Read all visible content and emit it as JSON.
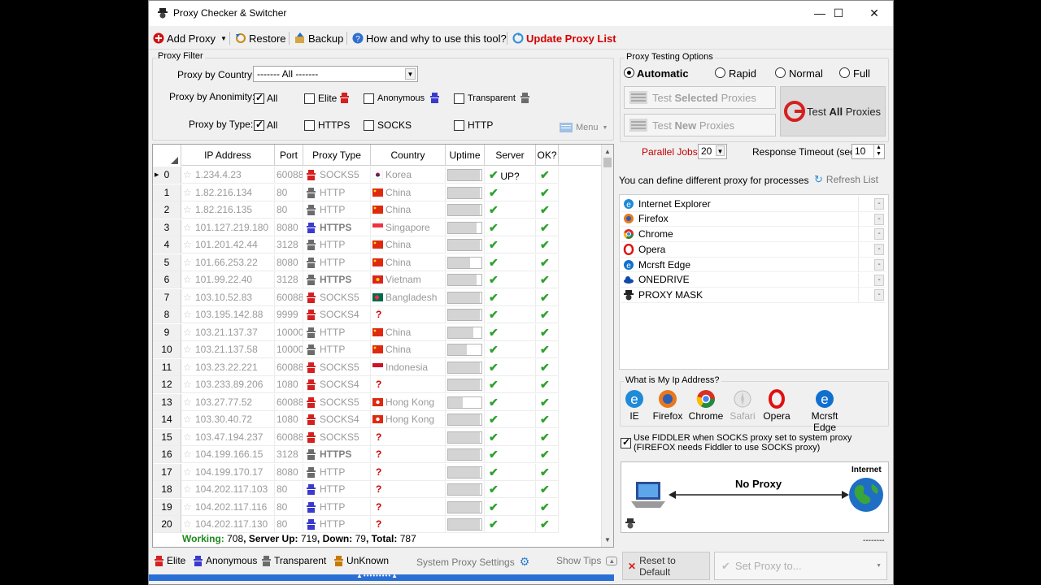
{
  "window": {
    "title": "Proxy Checker & Switcher",
    "minimize_glyph": "—",
    "maximize_glyph": "☐",
    "close_glyph": "✕"
  },
  "toolbar": {
    "add_proxy": "Add Proxy",
    "restore": "Restore",
    "backup": "Backup",
    "how_and_why": "How and why to use this tool?",
    "update_proxy_list": "Update Proxy List"
  },
  "filter": {
    "group_label": "Proxy Filter",
    "country_label": "Proxy by Country:",
    "country_value": "------- All -------",
    "anonymity_label": "Proxy by Anonimity:",
    "anonymity_options": [
      "All",
      "Elite",
      "Anonymous",
      "Transparent"
    ],
    "type_label": "Proxy by Type:",
    "type_options": [
      "All",
      "HTTPS",
      "SOCKS",
      "HTTP"
    ],
    "menu": "Menu"
  },
  "grid": {
    "headers": [
      "IP Address",
      "Port",
      "Proxy Type",
      "Country",
      "Uptime",
      "Server UP?",
      "OK?"
    ],
    "rows": [
      {
        "idx": "0",
        "ip": "1.234.4.23",
        "port": "60088",
        "type": "SOCKS5",
        "country": "Korea",
        "flag": "korea",
        "uptime": 0.95,
        "anon": "elite"
      },
      {
        "idx": "1",
        "ip": "1.82.216.134",
        "port": "80",
        "type": "HTTP",
        "country": "China",
        "flag": "china",
        "uptime": 0.95,
        "anon": "transparent"
      },
      {
        "idx": "2",
        "ip": "1.82.216.135",
        "port": "80",
        "type": "HTTP",
        "country": "China",
        "flag": "china",
        "uptime": 0.95,
        "anon": "transparent"
      },
      {
        "idx": "3",
        "ip": "101.127.219.180",
        "port": "8080",
        "type": "HTTPS",
        "country": "Singapore",
        "flag": "singapore",
        "uptime": 0.85,
        "anon": "anonymous",
        "bold": true
      },
      {
        "idx": "4",
        "ip": "101.201.42.44",
        "port": "3128",
        "type": "HTTP",
        "country": "China",
        "flag": "china",
        "uptime": 0.95,
        "anon": "transparent"
      },
      {
        "idx": "5",
        "ip": "101.66.253.22",
        "port": "8080",
        "type": "HTTP",
        "country": "China",
        "flag": "china",
        "uptime": 0.65,
        "anon": "transparent"
      },
      {
        "idx": "6",
        "ip": "101.99.22.40",
        "port": "3128",
        "type": "HTTPS",
        "country": "Vietnam",
        "flag": "vietnam",
        "uptime": 0.85,
        "anon": "transparent",
        "bold": true
      },
      {
        "idx": "7",
        "ip": "103.10.52.83",
        "port": "60088",
        "type": "SOCKS5",
        "country": "Bangladesh",
        "flag": "bangladesh",
        "uptime": 0.95,
        "anon": "elite"
      },
      {
        "idx": "8",
        "ip": "103.195.142.88",
        "port": "9999",
        "type": "SOCKS4",
        "country": "",
        "flag": "unknown",
        "uptime": 0.95,
        "anon": "elite"
      },
      {
        "idx": "9",
        "ip": "103.21.137.37",
        "port": "10000",
        "type": "HTTP",
        "country": "China",
        "flag": "china",
        "uptime": 0.75,
        "anon": "transparent"
      },
      {
        "idx": "10",
        "ip": "103.21.137.58",
        "port": "10000",
        "type": "HTTP",
        "country": "China",
        "flag": "china",
        "uptime": 0.55,
        "anon": "transparent"
      },
      {
        "idx": "11",
        "ip": "103.23.22.221",
        "port": "60088",
        "type": "SOCKS5",
        "country": "Indonesia",
        "flag": "indonesia",
        "uptime": 0.95,
        "anon": "elite"
      },
      {
        "idx": "12",
        "ip": "103.233.89.206",
        "port": "1080",
        "type": "SOCKS4",
        "country": "",
        "flag": "unknown",
        "uptime": 0.95,
        "anon": "elite"
      },
      {
        "idx": "13",
        "ip": "103.27.77.52",
        "port": "60088",
        "type": "SOCKS5",
        "country": "Hong Kong",
        "flag": "hongkong",
        "uptime": 0.45,
        "anon": "elite"
      },
      {
        "idx": "14",
        "ip": "103.30.40.72",
        "port": "1080",
        "type": "SOCKS4",
        "country": "Hong Kong",
        "flag": "hongkong",
        "uptime": 0.95,
        "anon": "elite"
      },
      {
        "idx": "15",
        "ip": "103.47.194.237",
        "port": "60088",
        "type": "SOCKS5",
        "country": "",
        "flag": "unknown",
        "uptime": 0.95,
        "anon": "elite"
      },
      {
        "idx": "16",
        "ip": "104.199.166.15",
        "port": "3128",
        "type": "HTTPS",
        "country": "",
        "flag": "unknown",
        "uptime": 0.95,
        "anon": "transparent",
        "bold": true
      },
      {
        "idx": "17",
        "ip": "104.199.170.17",
        "port": "8080",
        "type": "HTTP",
        "country": "",
        "flag": "unknown",
        "uptime": 0.95,
        "anon": "transparent"
      },
      {
        "idx": "18",
        "ip": "104.202.117.103",
        "port": "80",
        "type": "HTTP",
        "country": "",
        "flag": "unknown",
        "uptime": 0.95,
        "anon": "anonymous"
      },
      {
        "idx": "19",
        "ip": "104.202.117.116",
        "port": "80",
        "type": "HTTP",
        "country": "",
        "flag": "unknown",
        "uptime": 0.95,
        "anon": "anonymous"
      },
      {
        "idx": "20",
        "ip": "104.202.117.130",
        "port": "80",
        "type": "HTTP",
        "country": "",
        "flag": "unknown",
        "uptime": 0.95,
        "anon": "anonymous"
      }
    ],
    "status": {
      "working_label": "Working:",
      "working": "708",
      "server_up_label": "Server Up:",
      "server_up": "719",
      "down_label": "Down:",
      "down": "79",
      "total_label": "Total:",
      "total": "787"
    }
  },
  "legend": {
    "elite": "Elite",
    "anonymous": "Anonymous",
    "transparent": "Transparent",
    "unknown": "UnKnown",
    "system_proxy": "System Proxy Settings",
    "show_tips": "Show Tips"
  },
  "testing": {
    "group_label": "Proxy Testing Options",
    "modes": [
      "Automatic",
      "Rapid",
      "Normal",
      "Full"
    ],
    "selected_mode": "Automatic",
    "test_selected_a": "Test ",
    "test_selected_b": "Selected",
    "test_selected_c": " Proxies",
    "test_new_a": "Test ",
    "test_new_b": "New",
    "test_new_c": " Proxies",
    "test_all_a": "Test ",
    "test_all_b": "All",
    "test_all_c": " Proxies",
    "parallel_label": "Parallel Jobs:",
    "parallel_value": "20",
    "timeout_label": "Response Timeout (sec):",
    "timeout_value": "10"
  },
  "processes": {
    "define_text": "You can define different proxy for processes",
    "refresh": "Refresh List",
    "items": [
      "Internet Explorer",
      "Firefox",
      "Chrome",
      "Opera",
      "Mcrsft Edge",
      "ONEDRIVE",
      "PROXY MASK"
    ]
  },
  "myip": {
    "label": "What is My Ip Address?",
    "browsers": [
      "IE",
      "Firefox",
      "Chrome",
      "Safari",
      "Opera",
      "Mcrsft Edge"
    ]
  },
  "fiddler": {
    "line1": "Use FIDDLER when SOCKS proxy set to system proxy",
    "line2": "(FIREFOX needs Fiddler to use SOCKS proxy)"
  },
  "diagram": {
    "status": "No Proxy",
    "internet": "Internet",
    "dashes": "--------"
  },
  "footer": {
    "reset": "Reset to Default",
    "set_proxy": "Set Proxy to..."
  },
  "colors": {
    "update_red": "#d40000",
    "ok_green": "#2ea12e",
    "elite_red": "#d42020",
    "anonymous_blue": "#3a3acf",
    "transparent_gray": "#6b6b6b",
    "accent_blue": "#2a6fd6"
  }
}
